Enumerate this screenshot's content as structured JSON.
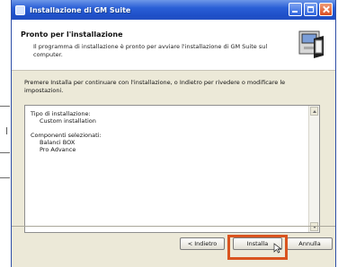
{
  "window": {
    "title": "Installazione di GM Suite"
  },
  "header": {
    "title": "Pronto per l'installazione",
    "subtitle": "Il programma di installazione è pronto per avviare l'installazione di GM Suite sul computer."
  },
  "content": {
    "instruction": "Premere Installa per continuare con l'installazione, o Indietro per rivedere o modificare le impostazioni.",
    "summary": {
      "install_type_label": "Tipo di installazione:",
      "install_type_value": "Custom installation",
      "components_label": "Componenti selezionati:",
      "components": [
        "Balanci BOX",
        "Pro Advance"
      ]
    }
  },
  "buttons": {
    "back": "< Indietro",
    "install": "Installa",
    "cancel": "Annulla"
  },
  "sidebar_fragment": {
    "glyph": "l"
  },
  "colors": {
    "titlebar": "#2a5fd6",
    "window_bg": "#ece9d8",
    "highlight": "#d9541f"
  },
  "icons": {
    "window_icon": "app-icon",
    "setup_graphic": "computer-setup-icon",
    "minimize": "minimize-icon",
    "maximize": "maximize-icon",
    "close": "close-icon",
    "cursor": "mouse-pointer-icon"
  }
}
